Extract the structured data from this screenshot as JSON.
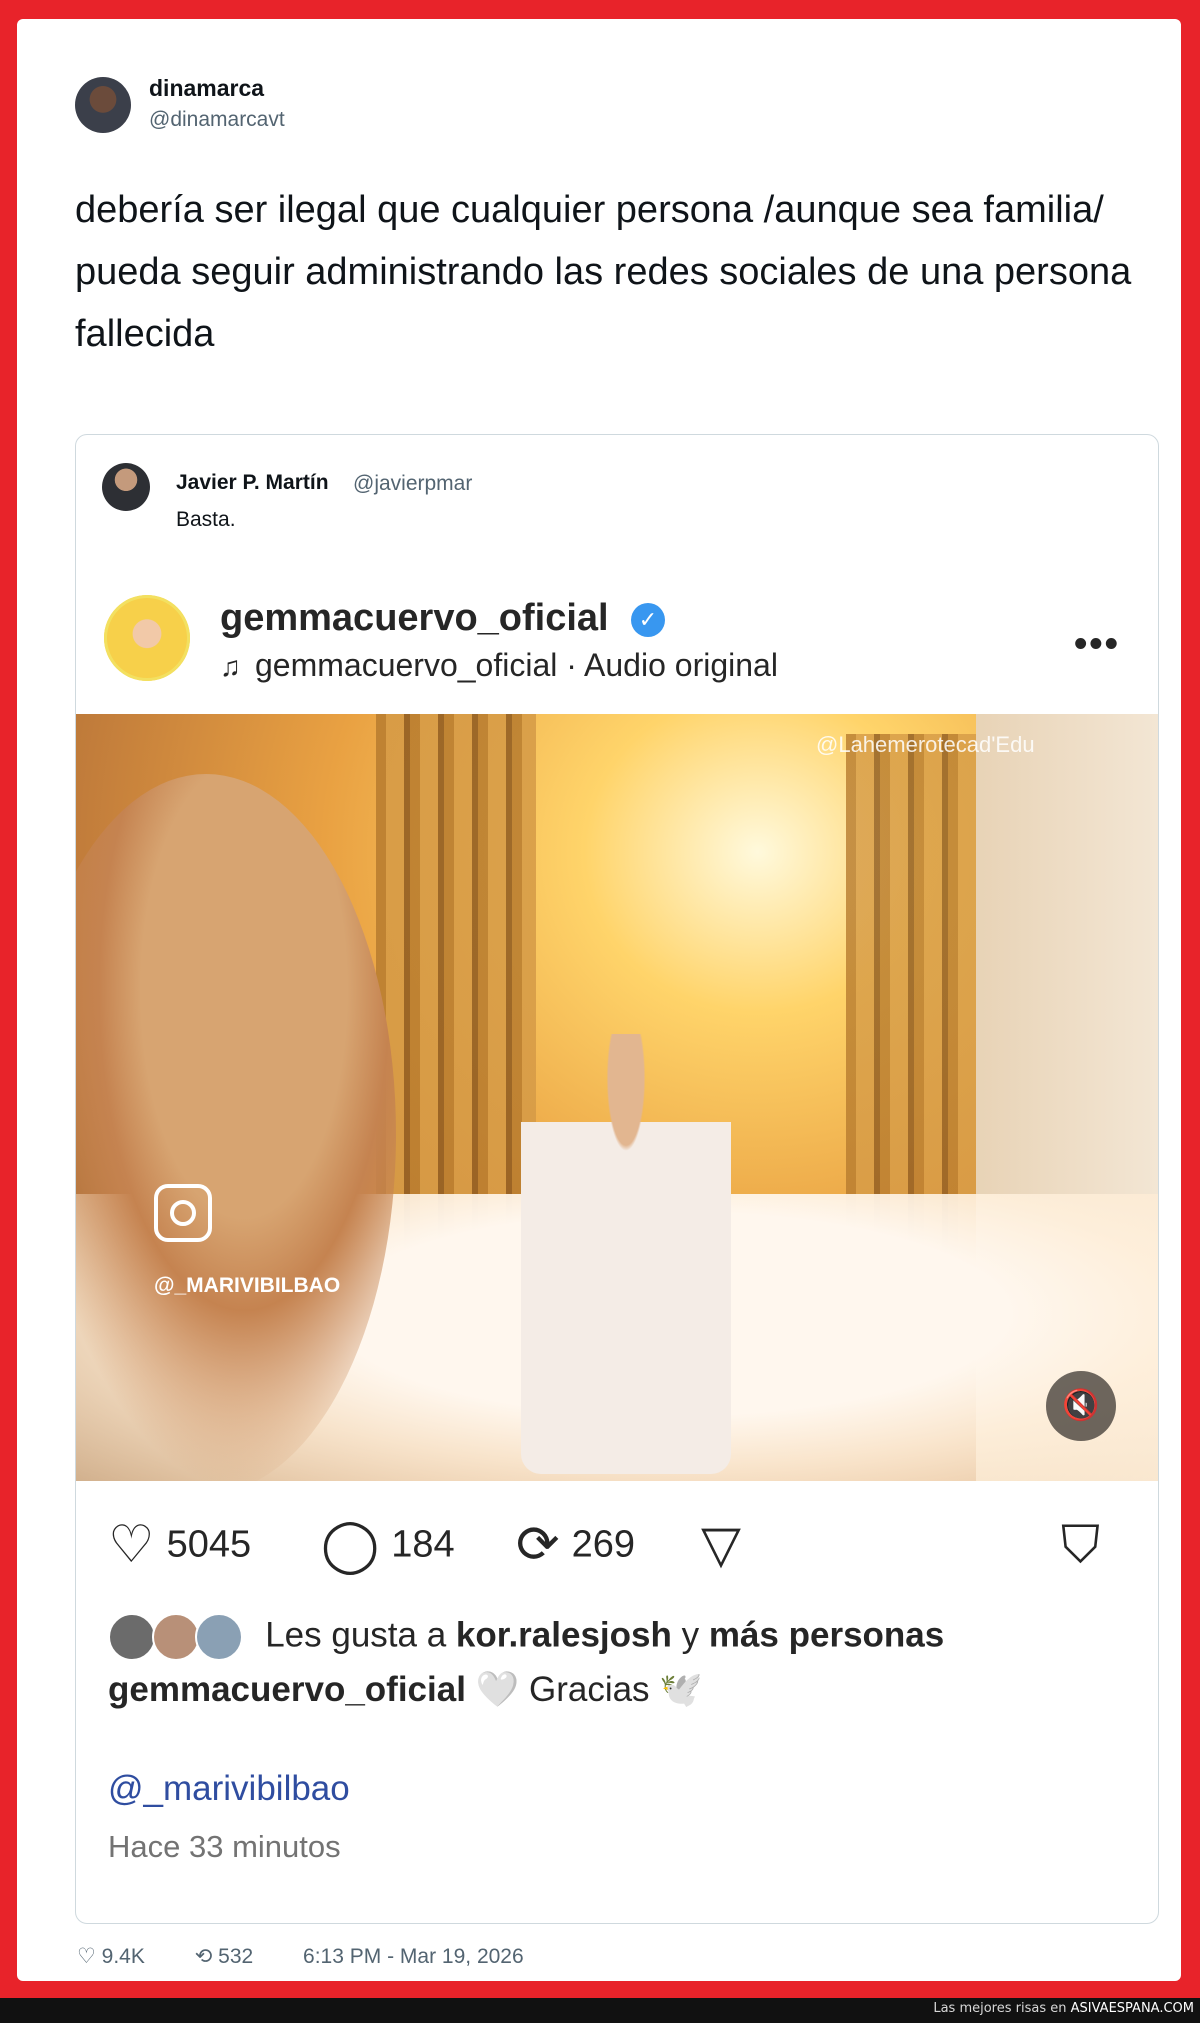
{
  "tweet": {
    "author_name": "dinamarca",
    "author_handle": "@dinamarcavt",
    "text": "debería ser ilegal que cualquier persona /aunque sea familia/ pueda seguir administrando las redes sociales de una persona fallecida",
    "likes": "9.4K",
    "retweets": "532",
    "timestamp": "6:13 PM - Mar 19, 2026"
  },
  "quote": {
    "author_name": "Javier P. Martín",
    "author_handle": "@javierpmar",
    "text": "Basta."
  },
  "instagram": {
    "username": "gemmacuervo_oficial",
    "audio": "gemmacuervo_oficial · Audio original",
    "watermark_top": "@Lahemerotecad'Edu",
    "watermark_user": "@_MARIVIBILBAO",
    "likes_count": "5045",
    "comments_count": "184",
    "reposts_count": "269",
    "liked_by_prefix": "Les gusta a",
    "liked_by_user": "kor.ralesjosh",
    "liked_by_joiner": "y",
    "liked_by_more": "más personas",
    "caption_user": "gemmacuervo_oficial",
    "caption_text": "🤍 Gracias 🕊️",
    "mention": "@_marivibilbao",
    "time_ago": "Hace 33 minutos"
  },
  "footer": {
    "prefix": "Las mejores risas en",
    "brand": "ASIVAESPANA.COM"
  },
  "colors": {
    "frame": "#e8232a",
    "verified": "#3897f0",
    "mention": "#2f4da0"
  }
}
